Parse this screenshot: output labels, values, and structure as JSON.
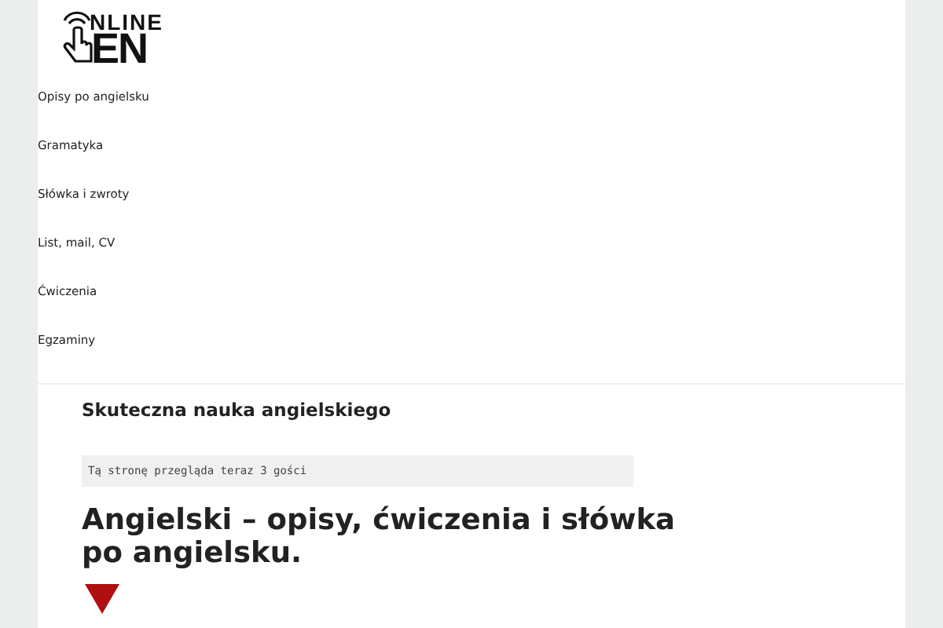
{
  "logo": {
    "top": "NLINE",
    "bottom": "EN"
  },
  "nav": {
    "items": [
      {
        "label": "Opisy po angielsku"
      },
      {
        "label": "Gramatyka"
      },
      {
        "label": "Słówka i zwroty"
      },
      {
        "label": "List, mail, CV"
      },
      {
        "label": "Ćwiczenia"
      },
      {
        "label": "Egzaminy"
      }
    ]
  },
  "content": {
    "tagline": "Skuteczna nauka angielskiego",
    "visitors": "Tą stronę przegląda teraz 3 gości",
    "heading": "Angielski – opisy, ćwiczenia i słówka po angielsku."
  }
}
